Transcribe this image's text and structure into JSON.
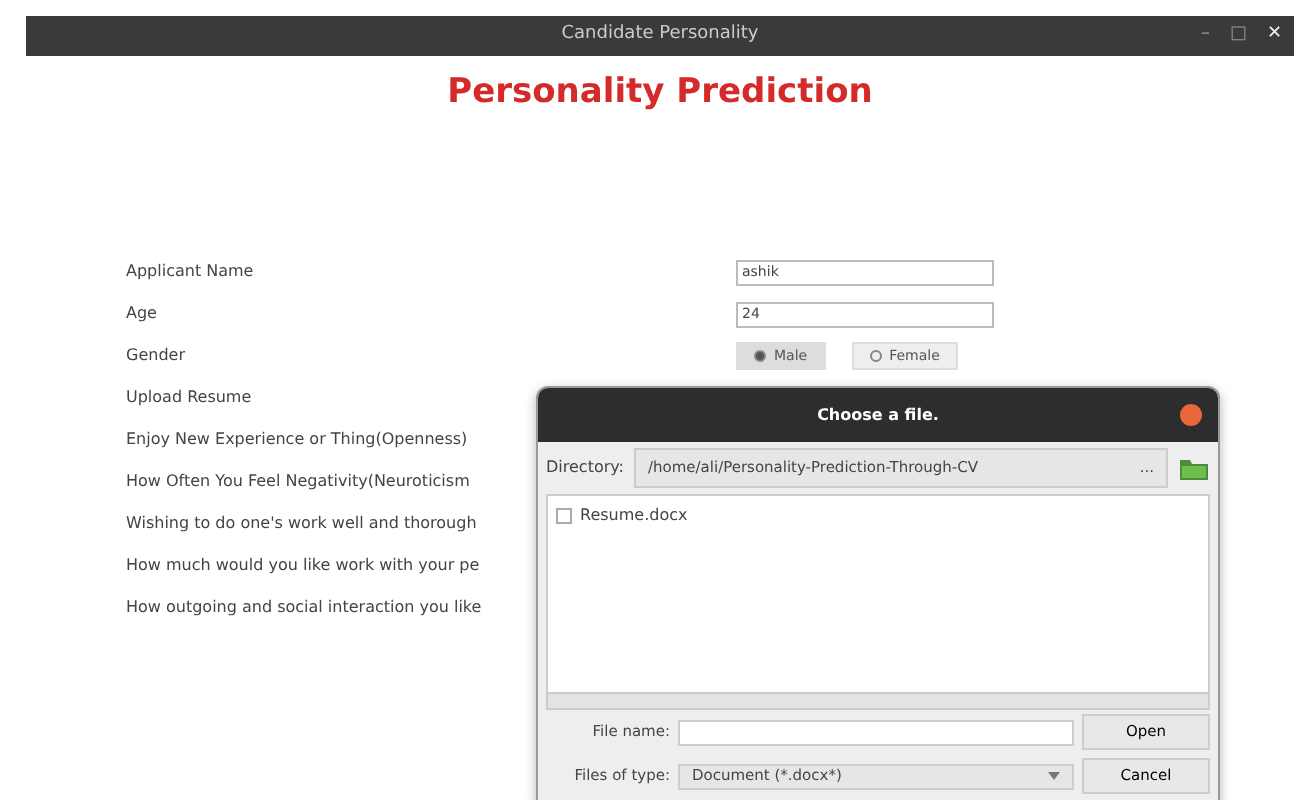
{
  "window": {
    "title": "Candidate Personality",
    "controls": [
      "–",
      "□",
      "✕"
    ]
  },
  "heading": "Personality Prediction",
  "form": [
    {
      "label": "Applicant Name",
      "kind": "text",
      "value": "ashik"
    },
    {
      "label": "Age",
      "kind": "text",
      "value": "24"
    },
    {
      "label": "Gender",
      "kind": "radio",
      "options": [
        {
          "label": "Male",
          "selected": true
        },
        {
          "label": "Female",
          "selected": false
        }
      ]
    },
    {
      "label": "Upload Resume",
      "kind": "none"
    },
    {
      "label": "Enjoy New Experience or Thing(Openness)",
      "kind": "none"
    },
    {
      "label": "How Often You Feel Negativity(Neuroticism",
      "kind": "none"
    },
    {
      "label": "Wishing to do one's work well and thorough",
      "kind": "none"
    },
    {
      "label": "How much would you like work with your pe",
      "kind": "none"
    },
    {
      "label": "How outgoing and social interaction you like",
      "kind": "none"
    }
  ],
  "dialog": {
    "title": "Choose a file.",
    "directory_label": "Directory:",
    "directory": "/home/ali/Personality-Prediction-Through-CV",
    "browse": "...",
    "files": [
      {
        "name": "Resume.docx",
        "selected": false
      }
    ],
    "file_name_label": "File name:",
    "file_type_label": "Files of type:",
    "file_type": "Document (*.docx*)",
    "buttons": [
      "Open",
      "Cancel"
    ]
  }
}
